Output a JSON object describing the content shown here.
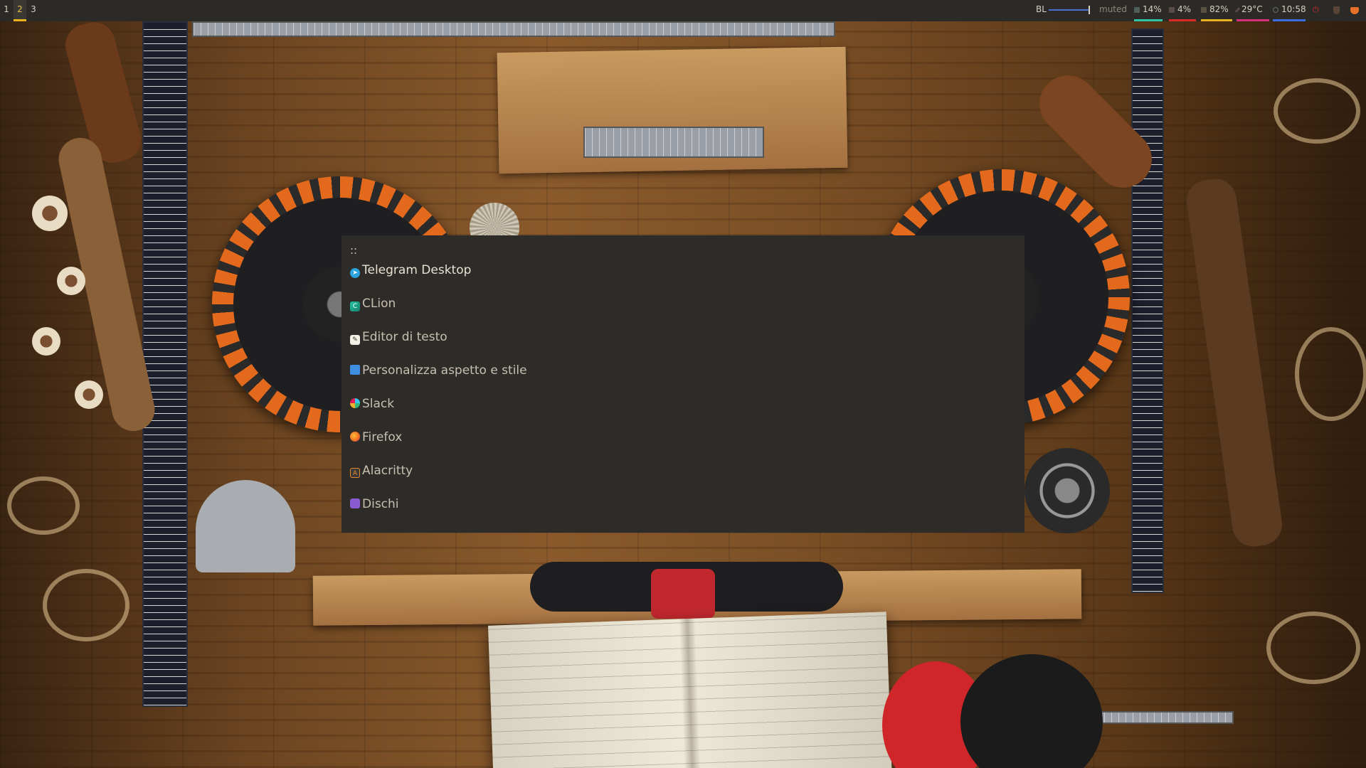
{
  "topbar": {
    "workspaces": [
      {
        "label": "1",
        "active": false
      },
      {
        "label": "2",
        "active": true
      },
      {
        "label": "3",
        "active": false
      }
    ],
    "backlight_label": "BL",
    "volume": "muted",
    "cpu": "14%",
    "memory": "4%",
    "disk": "82%",
    "temperature": "29°C",
    "clock": "10:58",
    "colors": {
      "cpu": "#2ec4a4",
      "memory": "#d92a2a",
      "disk": "#e9b320",
      "temperature": "#d8307a",
      "clock": "#3a6ee0",
      "power": "#d92a2a",
      "backlight": "#4a6fd0"
    }
  },
  "launcher": {
    "prompt": "::",
    "items": [
      {
        "label": "Telegram Desktop",
        "icon": "telegram-icon",
        "icon_color": "#2aa3df",
        "selected": true
      },
      {
        "label": "CLion",
        "icon": "clion-icon",
        "icon_color": "#21c6a4",
        "selected": false
      },
      {
        "label": "Editor di testo",
        "icon": "text-editor-icon",
        "icon_color": "#f0c040",
        "selected": false
      },
      {
        "label": "Personalizza aspetto e stile",
        "icon": "appearance-settings-icon",
        "icon_color": "#3f8fe0",
        "selected": false
      },
      {
        "label": "Slack",
        "icon": "slack-icon",
        "icon_color": "#e8e8e8",
        "selected": false
      },
      {
        "label": "Firefox",
        "icon": "firefox-icon",
        "icon_color": "#f06a20",
        "selected": false
      },
      {
        "label": "Alacritty",
        "icon": "alacritty-icon",
        "icon_color": "#e88a2a",
        "selected": false
      },
      {
        "label": "Dischi",
        "icon": "disks-icon",
        "icon_color": "#8a5ad0",
        "selected": false
      }
    ]
  }
}
